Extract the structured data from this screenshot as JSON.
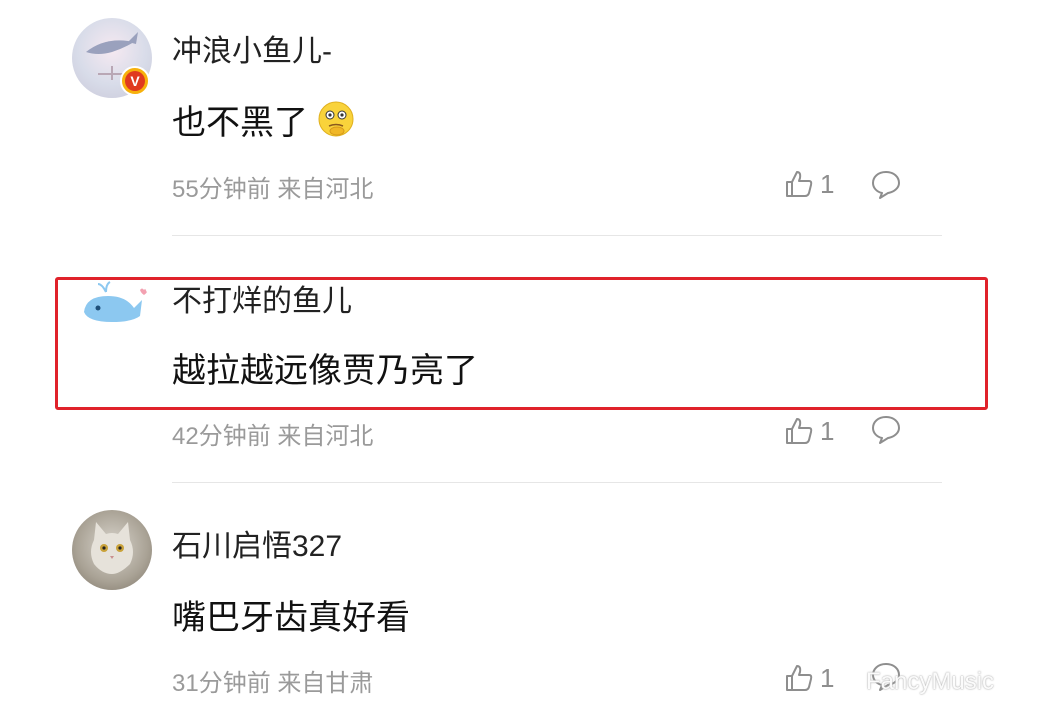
{
  "comments": [
    {
      "username": "冲浪小鱼儿-",
      "content": "也不黑了",
      "emoji": "thinking-emoji",
      "time": "55分钟前",
      "location": "来自河北",
      "likes": "1",
      "verified": true,
      "badge_label": "V"
    },
    {
      "username": "不打烊的鱼儿",
      "content": "越拉越远像贾乃亮了",
      "time": "42分钟前",
      "location": "来自河北",
      "likes": "1",
      "highlighted": true
    },
    {
      "username": "石川启悟327",
      "content": "嘴巴牙齿真好看",
      "time": "31分钟前",
      "location": "来自甘肃",
      "likes": "1"
    }
  ],
  "watermark": "FancyMusic",
  "colors": {
    "highlight_border": "#e0222a",
    "meta_text": "#9a9a9a",
    "verified_badge": "#f7b10c"
  }
}
